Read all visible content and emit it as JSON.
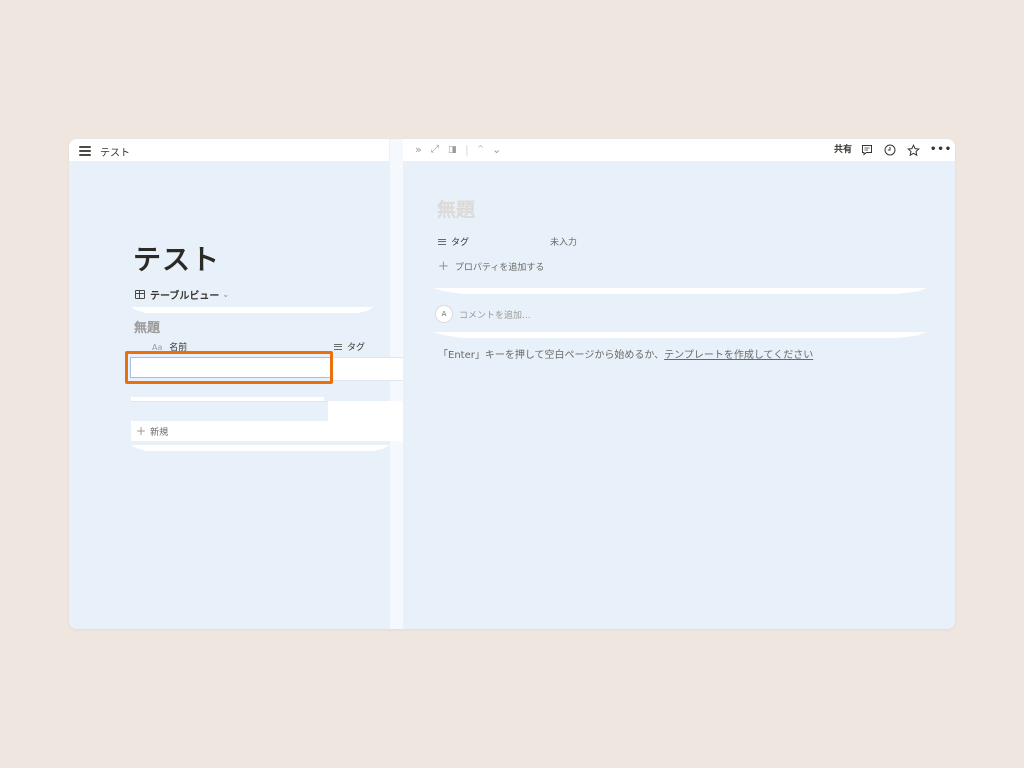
{
  "left": {
    "window_title": "テスト",
    "db_title": "テスト",
    "view_tab": "テーブルビュー",
    "group_title": "無題",
    "columns": {
      "name_prefix": "Aa",
      "name": "名前",
      "tag": "タグ"
    },
    "new_row_label": "新規"
  },
  "topbar": {
    "share_label": "共有"
  },
  "page": {
    "title": "無題",
    "properties": [
      {
        "name": "タグ",
        "value": "未入力"
      }
    ],
    "add_property_label": "プロパティを追加する",
    "comment_avatar": "A",
    "comment_placeholder": "コメントを追加...",
    "hint_prefix": "「Enter」キーを押して空白ページから始めるか、",
    "hint_link": "テンプレートを作成してください"
  },
  "colors": {
    "background": "#efe6e0",
    "pane": "#e8f0f9",
    "highlight": "#e8700f"
  }
}
